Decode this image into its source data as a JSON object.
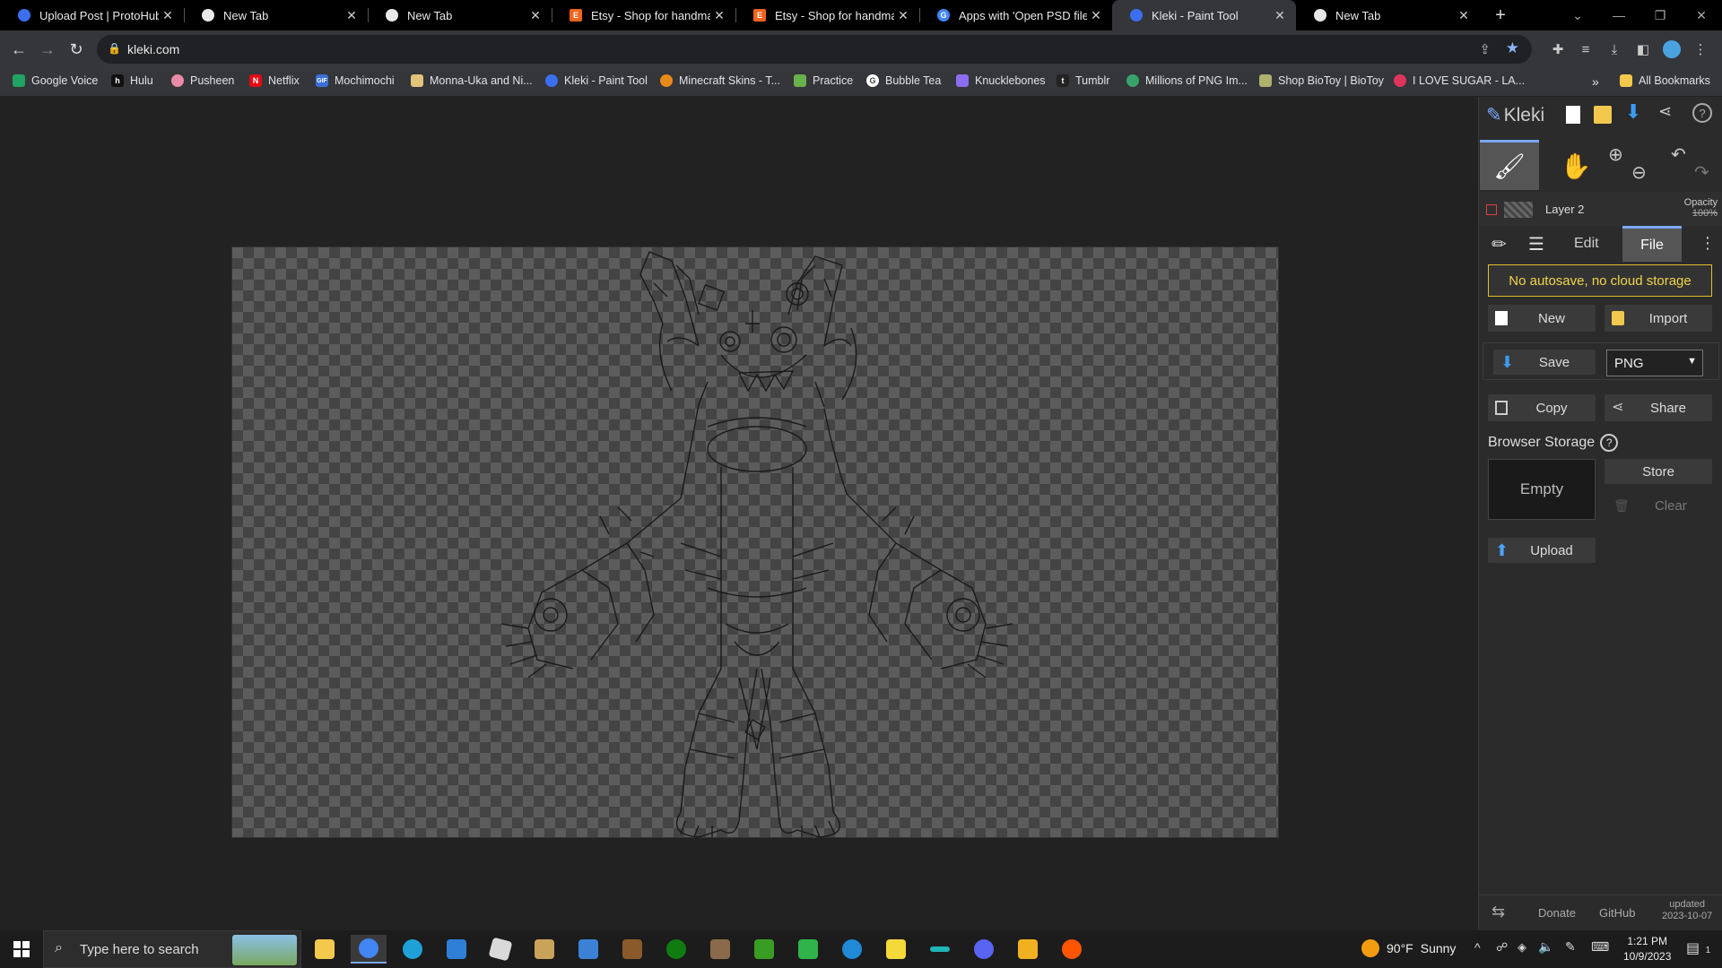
{
  "tabs": [
    {
      "title": "Upload Post | ProtoHub",
      "icon": "protohub-icon",
      "color": "#3b6ff0"
    },
    {
      "title": "New Tab",
      "icon": "chrome-icon",
      "color": "#e8e8e8"
    },
    {
      "title": "New Tab",
      "icon": "chrome-icon",
      "color": "#e8e8e8"
    },
    {
      "title": "Etsy - Shop for handmade",
      "icon": "etsy-icon",
      "color": "#f1641e"
    },
    {
      "title": "Etsy - Shop for handmade",
      "icon": "etsy-icon",
      "color": "#f1641e"
    },
    {
      "title": "Apps with 'Open PSD files'",
      "icon": "google-icon",
      "color": "#4285f4"
    },
    {
      "title": "Kleki - Paint Tool",
      "icon": "kleki-icon",
      "color": "#3b6ff0",
      "active": true
    },
    {
      "title": "New Tab",
      "icon": "chrome-icon",
      "color": "#e8e8e8"
    }
  ],
  "address": {
    "url": "kleki.com"
  },
  "bookmarks": [
    {
      "label": "Google Voice",
      "color": "#1ea362"
    },
    {
      "label": "Hulu",
      "color": "#111"
    },
    {
      "label": "Pusheen",
      "color": "#e98aa8"
    },
    {
      "label": "Netflix",
      "color": "#e50914"
    },
    {
      "label": "Mochimochi",
      "color": "#3a6fd8"
    },
    {
      "label": "Monna-Uka and Ni...",
      "color": "#e3c27a"
    },
    {
      "label": "Kleki - Paint Tool",
      "color": "#3b6ff0"
    },
    {
      "label": "Minecraft Skins - T...",
      "color": "#e88a1a"
    },
    {
      "label": "Practice",
      "color": "#6ab04c"
    },
    {
      "label": "Bubble Tea",
      "color": "#ffffff"
    },
    {
      "label": "Knucklebones",
      "color": "#8c6cf0"
    },
    {
      "label": "Tumblr",
      "color": "#222"
    },
    {
      "label": "Millions of PNG Im...",
      "color": "#37a36b"
    },
    {
      "label": "Shop BioToy | BioToy",
      "color": "#b0b070"
    },
    {
      "label": "I LOVE SUGAR - LA...",
      "color": "#e0345c"
    }
  ],
  "all_bookmarks": "All Bookmarks",
  "kleki": {
    "logo": "Kleki",
    "layer_name": "Layer 2",
    "opacity_label": "Opacity",
    "opacity_value": "100%",
    "tabs": [
      "Edit",
      "File"
    ],
    "active_tab": "File",
    "notice": "No autosave, no cloud storage",
    "new": "New",
    "import": "Import",
    "save": "Save",
    "format": "PNG",
    "formats": [
      "PNG"
    ],
    "copy": "Copy",
    "share": "Share",
    "browser_storage": "Browser Storage",
    "storage_status": "Empty",
    "store": "Store",
    "clear": "Clear",
    "upload": "Upload",
    "footer": {
      "donate": "Donate",
      "github": "GitHub",
      "updated": "updated",
      "date": "2023-10-07"
    }
  },
  "taskbar": {
    "search_placeholder": "Type here to search",
    "weather_temp": "90°F",
    "weather_desc": "Sunny",
    "time": "1:21 PM",
    "date": "10/9/2023",
    "notifications": "1",
    "apps": [
      {
        "icon": "file-explorer-icon",
        "color": "#f2c94c"
      },
      {
        "icon": "chrome-icon",
        "color": "#4285f4"
      },
      {
        "icon": "edge-icon",
        "color": "#1fa1d8"
      },
      {
        "icon": "store-icon",
        "color": "#2f7fd6"
      },
      {
        "icon": "roblox-icon",
        "color": "#d9d9d9"
      },
      {
        "icon": "app-icon",
        "color": "#c9a35a"
      },
      {
        "icon": "app-icon",
        "color": "#3b82d6"
      },
      {
        "icon": "minecraft-icon",
        "color": "#8b5a2b"
      },
      {
        "icon": "xbox-icon",
        "color": "#107c10"
      },
      {
        "icon": "app-icon",
        "color": "#8a6a4a"
      },
      {
        "icon": "minecraft-icon",
        "color": "#3a9d23"
      },
      {
        "icon": "spreadsheet-icon",
        "color": "#30b34a"
      },
      {
        "icon": "app-icon",
        "color": "#1f8ad6"
      },
      {
        "icon": "sticky-notes-icon",
        "color": "#f5d93a"
      },
      {
        "icon": "app-icon",
        "color": "#1fb6b6"
      },
      {
        "icon": "discord-icon",
        "color": "#5865f2"
      },
      {
        "icon": "app-icon",
        "color": "#f0b020"
      },
      {
        "icon": "soundcloud-icon",
        "color": "#ff5500"
      }
    ]
  }
}
